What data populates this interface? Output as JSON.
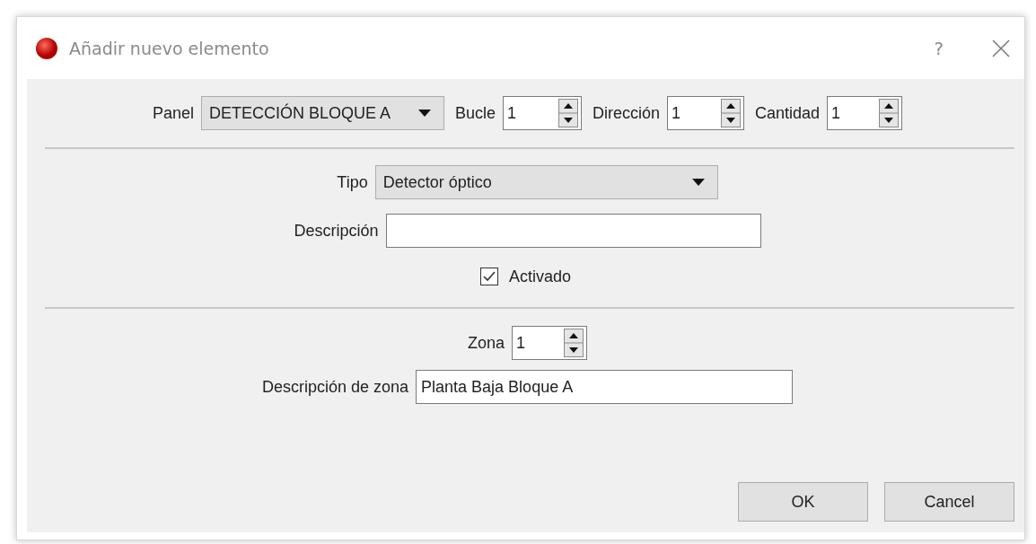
{
  "window": {
    "title": "Añadir nuevo elemento",
    "help": "?"
  },
  "top_row": [
    {
      "label": "Panel",
      "kind": "combo",
      "value": "DETECCIÓN BLOQUE A"
    },
    {
      "label": "Bucle",
      "kind": "spin",
      "value": "1"
    },
    {
      "label": "Dirección",
      "kind": "spin",
      "value": "1"
    },
    {
      "label": "Cantidad",
      "kind": "spin",
      "value": "1"
    }
  ],
  "device": {
    "fields": [
      {
        "label": "Tipo",
        "kind": "combo",
        "value": "Detector óptico"
      },
      {
        "label": "Descripción",
        "kind": "text"
      }
    ],
    "enabled": {
      "label": "Activado",
      "checked": true
    }
  },
  "zone": {
    "fields": [
      {
        "label": "Zona",
        "kind": "spin",
        "value": "1"
      },
      {
        "label": "Descripción de zona",
        "kind": "text",
        "value": "Planta Baja Bloque A"
      }
    ]
  },
  "buttons": [
    "OK",
    "Cancel"
  ]
}
